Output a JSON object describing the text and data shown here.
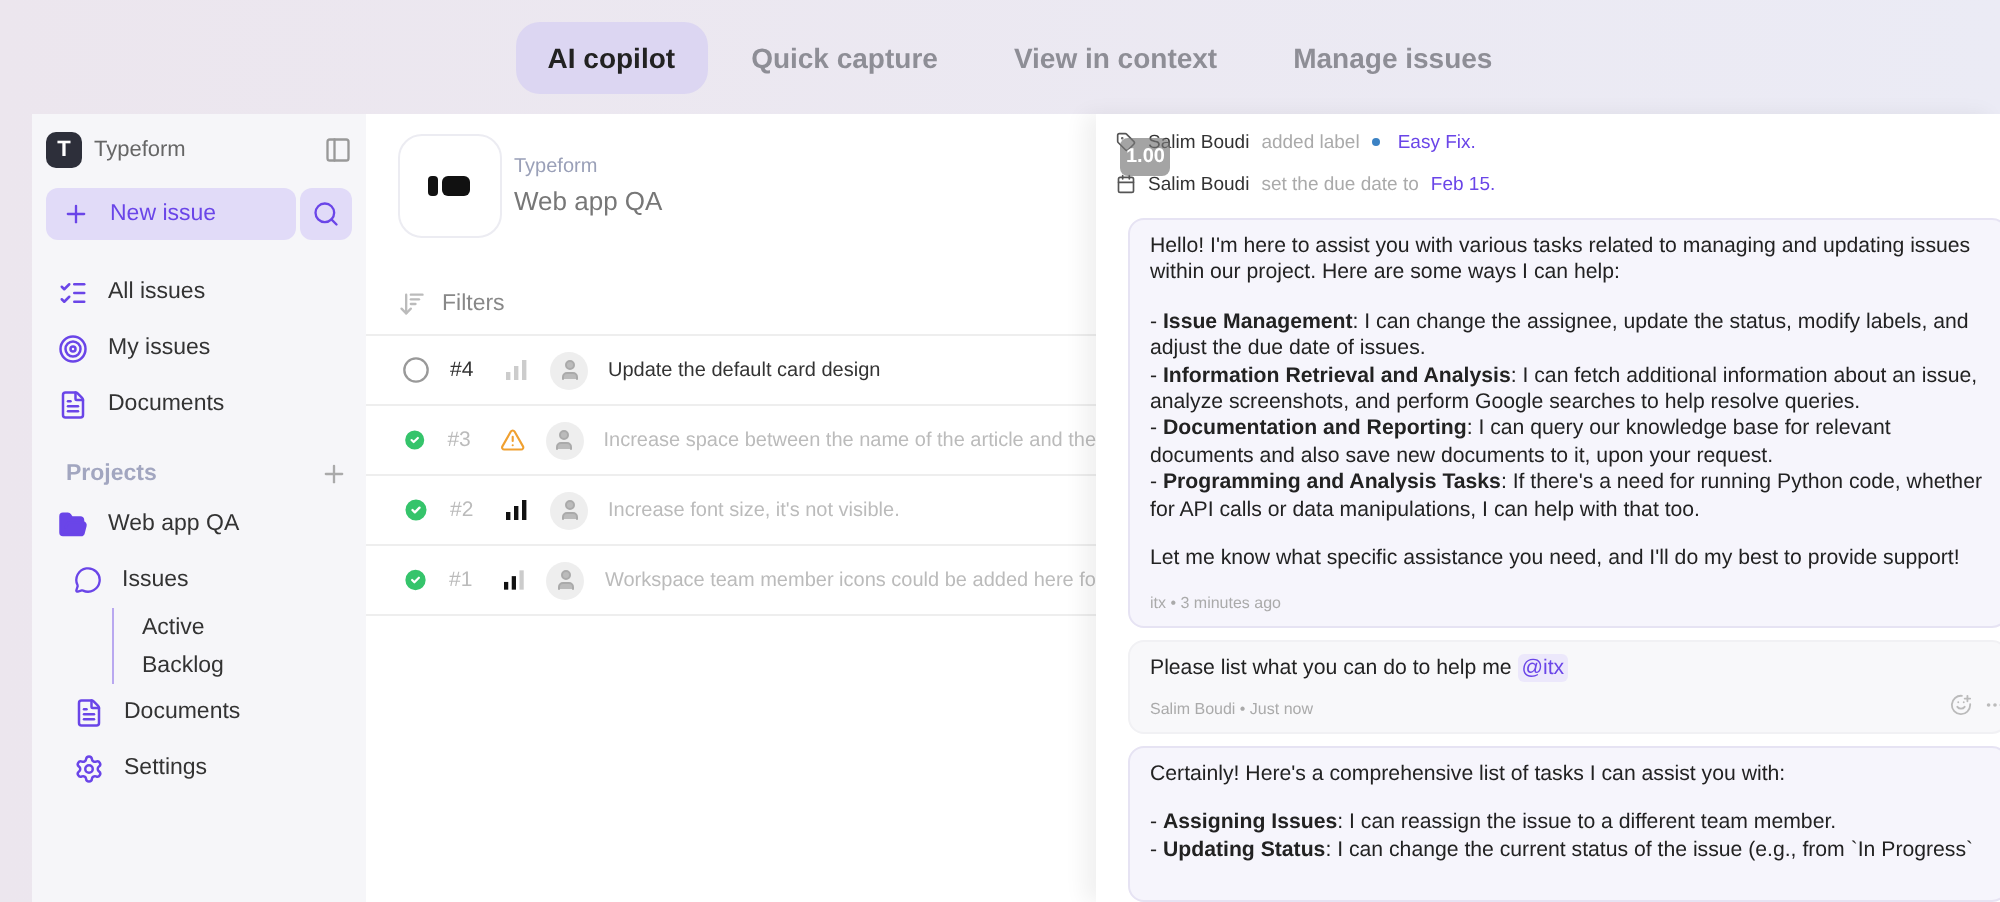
{
  "top_tabs": [
    {
      "label": "AI copilot",
      "selected": true
    },
    {
      "label": "Quick capture",
      "selected": false
    },
    {
      "label": "View in context",
      "selected": false
    },
    {
      "label": "Manage issues",
      "selected": false
    }
  ],
  "sidebar": {
    "workspace_initial": "T",
    "workspace_name": "Typeform",
    "new_issue": "New issue",
    "nav": [
      {
        "label": "All issues",
        "kind": "list"
      },
      {
        "label": "My issues",
        "kind": "target"
      },
      {
        "label": "Documents",
        "kind": "doc"
      }
    ],
    "projects_label": "Projects",
    "project": {
      "name": "Web app QA",
      "children": [
        {
          "label": "Issues",
          "kind": "issues",
          "children": [
            {
              "label": "Active"
            },
            {
              "label": "Backlog"
            }
          ]
        },
        {
          "label": "Documents",
          "kind": "doc"
        },
        {
          "label": "Settings",
          "kind": "settings"
        }
      ]
    }
  },
  "header": {
    "workspace": "Typeform",
    "project": "Web app QA"
  },
  "filters": "Filters",
  "issues": [
    {
      "id": "#4",
      "done": false,
      "kind": "low",
      "title": "Update the default card design"
    },
    {
      "id": "#3",
      "done": true,
      "kind": "urgent",
      "title": "Increase space between the name of the article and the"
    },
    {
      "id": "#2",
      "done": true,
      "kind": "high",
      "title": "Increase font size, it's not visible."
    },
    {
      "id": "#1",
      "done": true,
      "kind": "medium",
      "title": "Workspace team member icons could be added here fo"
    }
  ],
  "activity": [
    {
      "kind": "label",
      "actor": "Salim Boudi",
      "action": "added label",
      "value": "Easy Fix.",
      "color": "#3b82c4"
    },
    {
      "kind": "date",
      "actor": "Salim Boudi",
      "action": "set the due date to",
      "value": "Feb 15."
    }
  ],
  "speed_badge": "1.00",
  "messages": [
    {
      "kind": "bot",
      "paragraphs": [
        "Hello! I'm here to assist you with various tasks related to managing and updating issues within our project. Here are some ways I can help:",
        "- **Issue Management**: I can change the assignee, update the status, modify labels, and adjust the due date of issues.\n- **Information Retrieval and Analysis**: I can fetch additional information about an issue, analyze screenshots, and perform Google searches to help resolve queries.\n- **Documentation and Reporting**: I can query our knowledge base for relevant documents and also save new documents to it, upon your request.\n- **Programming and Analysis Tasks**: If there's a need for running Python code, whether for API calls or data manipulations, I can help with that too.",
        "Let me know what specific assistance you need, and I'll do my best to provide support!"
      ],
      "meta": "itx • 3 minutes ago"
    },
    {
      "kind": "user",
      "text": "Please list what you can do to help me",
      "mention": "@itx",
      "meta": "Salim Boudi • Just now"
    },
    {
      "kind": "bot",
      "paragraphs": [
        "Certainly! Here's a comprehensive list of tasks I can assist you with:",
        "- **Assigning Issues**: I can reassign the issue to a different team member.\n- **Updating Status**: I can change the current status of the issue (e.g., from `In Progress`"
      ]
    }
  ]
}
